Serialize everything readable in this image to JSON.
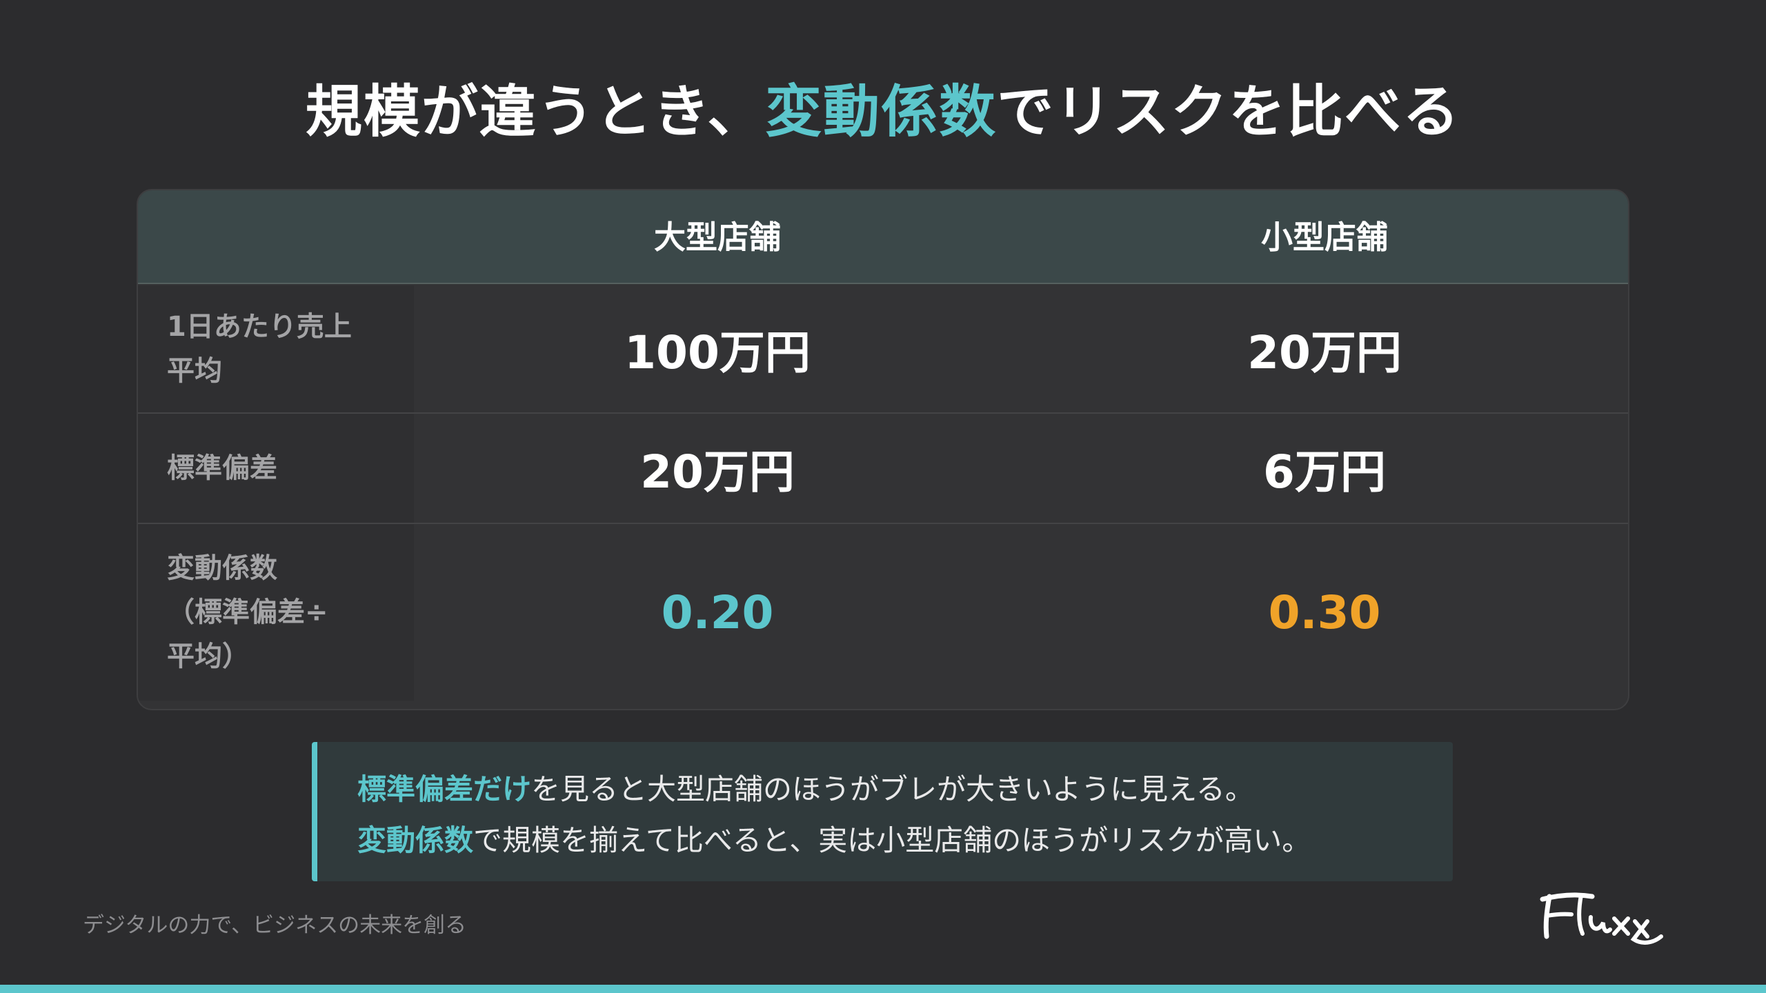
{
  "title": {
    "before": "規模が違うとき、",
    "accent": "変動係数",
    "after": "でリスクを比べる"
  },
  "table": {
    "headers": [
      "大型店舗",
      "小型店舗"
    ],
    "rows": [
      {
        "label_line1": "1日あたり売上",
        "label_line2": "平均",
        "large": "100万円",
        "small": "20万円"
      },
      {
        "label_line1": "標準偏差",
        "large": "20万円",
        "small": "6万円"
      },
      {
        "label_line1": "変動係数",
        "label_line2": "（標準偏差÷",
        "label_line3": "平均）",
        "large": "0.20",
        "small": "0.30"
      }
    ]
  },
  "note": {
    "line1_hl": "標準偏差だけ",
    "line1_rest": "を見ると大型店舗のほうがブレが大きいように見える。",
    "line2_hl": "変動係数",
    "line2_rest": "で規模を揃えて比べると、実は小型店舗のほうがリスクが高い。"
  },
  "footer": {
    "tagline": "デジタルの力で、ビジネスの未来を創る",
    "logo_text": "Fluxx"
  },
  "colors": {
    "accent": "#5cc6cc",
    "highlight_orange": "#f0a329",
    "background": "#2c2c2e"
  }
}
